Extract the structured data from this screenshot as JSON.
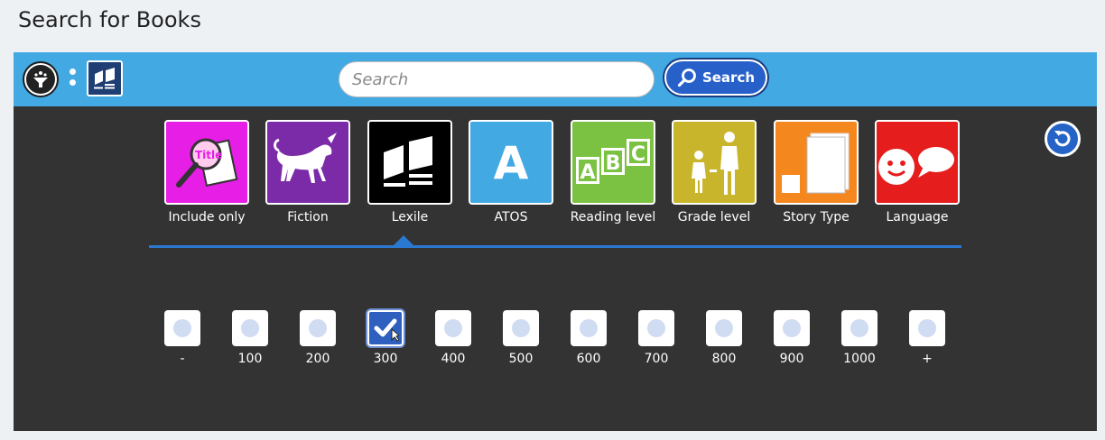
{
  "page": {
    "title": "Search for Books"
  },
  "toolbar": {
    "search_placeholder": "Search",
    "search_value": "",
    "search_button_label": "Search"
  },
  "categories": [
    {
      "label": "Include only",
      "color": "#e61ee6",
      "icon": "title-magnifier-icon"
    },
    {
      "label": "Fiction",
      "color": "#7b2ba8",
      "icon": "unicorn-icon"
    },
    {
      "label": "Lexile",
      "color": "#000000",
      "icon": "books-icon",
      "selected": true
    },
    {
      "label": "ATOS",
      "color": "#42a9e3",
      "icon": "letter-a-icon"
    },
    {
      "label": "Reading level",
      "color": "#7cc242",
      "icon": "abc-blocks-icon"
    },
    {
      "label": "Grade level",
      "color": "#c9b52b",
      "icon": "child-adult-icon"
    },
    {
      "label": "Story Type",
      "color": "#f5871f",
      "icon": "book-sizes-icon"
    },
    {
      "label": "Language",
      "color": "#e51d1d",
      "icon": "speech-face-icon"
    }
  ],
  "levels": [
    {
      "label": "-",
      "checked": false
    },
    {
      "label": "100",
      "checked": false
    },
    {
      "label": "200",
      "checked": false
    },
    {
      "label": "300",
      "checked": true
    },
    {
      "label": "400",
      "checked": false
    },
    {
      "label": "500",
      "checked": false
    },
    {
      "label": "600",
      "checked": false
    },
    {
      "label": "700",
      "checked": false
    },
    {
      "label": "800",
      "checked": false
    },
    {
      "label": "900",
      "checked": false
    },
    {
      "label": "1000",
      "checked": false
    },
    {
      "label": "+",
      "checked": false
    }
  ]
}
